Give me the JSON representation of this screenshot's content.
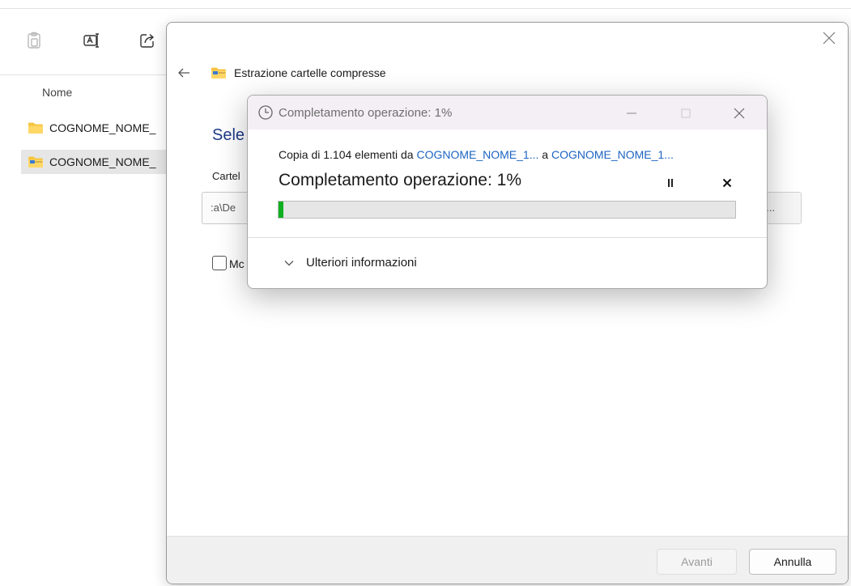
{
  "explorer": {
    "column_header": "Nome",
    "files": [
      {
        "name": "COGNOME_NOME_",
        "type": "folder"
      },
      {
        "name": "COGNOME_NOME_",
        "type": "zip-folder"
      }
    ]
  },
  "wizard": {
    "title": "Estrazione cartelle compresse",
    "heading": "Sele",
    "field_label": "Cartel",
    "path_value": ":a\\De",
    "browse_label": "a...",
    "checkbox_label": "Mc",
    "next_label": "Avanti",
    "cancel_label": "Annulla"
  },
  "progress": {
    "title": "Completamento operazione: 1%",
    "desc_prefix": "Copia di 1.104 elementi da ",
    "source": "COGNOME_NOME_1...",
    "desc_mid": " a ",
    "destination": "COGNOME_NOME_1...",
    "status": "Completamento operazione: 1%",
    "percent": 1,
    "more_info_label": "Ulteriori informazioni"
  },
  "colors": {
    "progress_green": "#0fb021",
    "link_blue": "#1d64c2",
    "heading_blue": "#1f3a8a",
    "titlebar_tint": "#f4eef5"
  }
}
